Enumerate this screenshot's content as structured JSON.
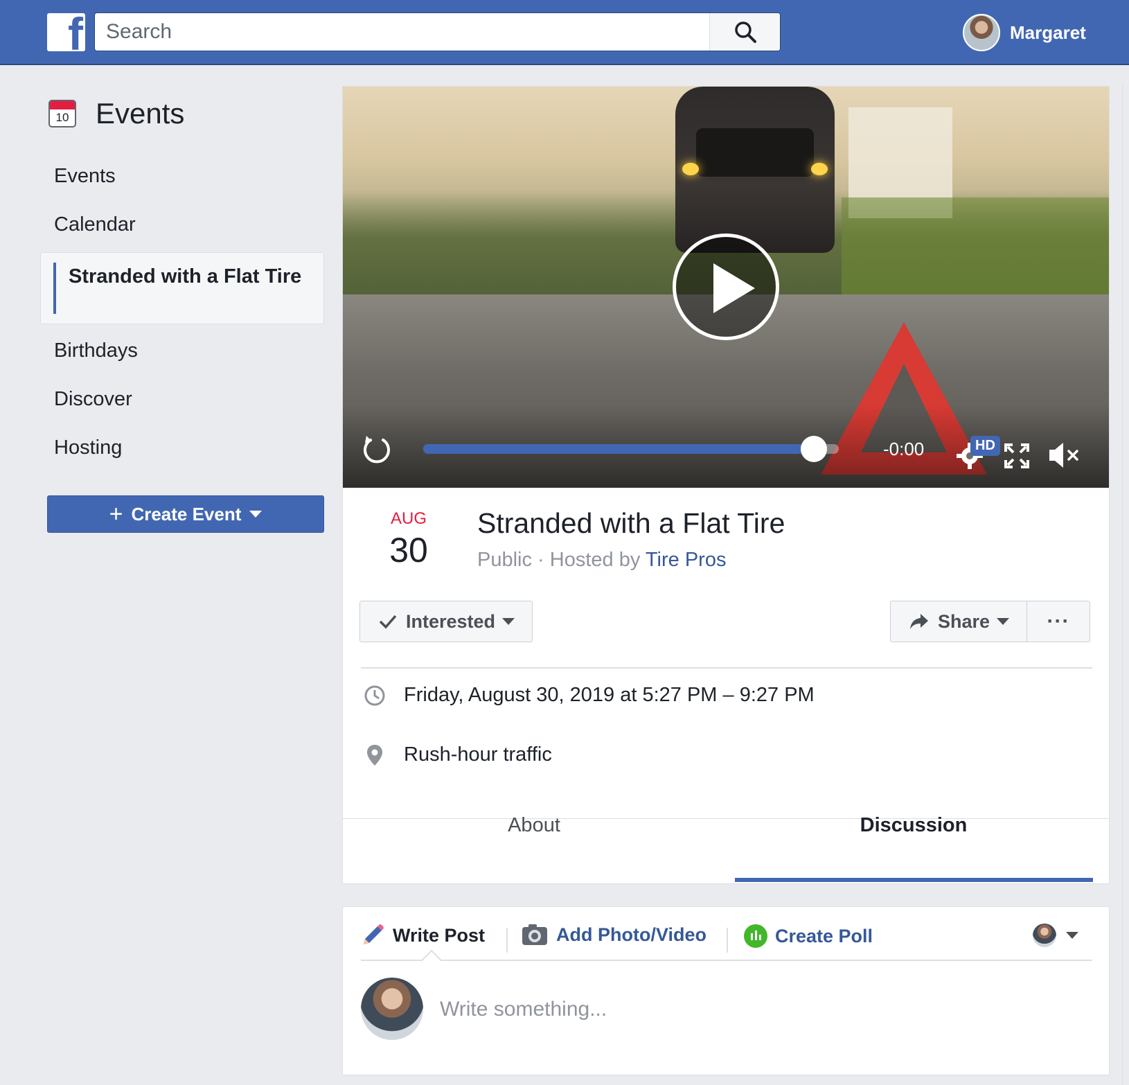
{
  "topbar": {
    "logo_letter": "f",
    "search_placeholder": "Search",
    "user_name": "Margaret"
  },
  "sidebar": {
    "title": "Events",
    "calendar_icon_number": "10",
    "items": [
      {
        "label": "Events"
      },
      {
        "label": "Calendar"
      },
      {
        "label": "Stranded with a Flat Tire",
        "active": true
      },
      {
        "label": "Birthdays"
      },
      {
        "label": "Discover"
      },
      {
        "label": "Hosting"
      }
    ],
    "create_button_label": "Create Event"
  },
  "video": {
    "time_remaining": "-0:00",
    "progress": 0.94,
    "hd_label": "HD"
  },
  "event": {
    "month": "AUG",
    "day": "30",
    "title": "Stranded with a Flat Tire",
    "privacy": "Public",
    "separator": " · ",
    "hosted_by_prefix": "Hosted by ",
    "host": "Tire Pros",
    "interested_label": "Interested",
    "share_label": "Share",
    "more_label": "···",
    "datetime": "Friday, August 30, 2019 at 5:27 PM – 9:27 PM",
    "location": "Rush-hour traffic"
  },
  "tabs": [
    {
      "label": "About",
      "active": false
    },
    {
      "label": "Discussion",
      "active": true
    }
  ],
  "composer": {
    "write_post_label": "Write Post",
    "add_photo_label": "Add Photo/Video",
    "create_poll_label": "Create Poll",
    "placeholder": "Write something..."
  },
  "colors": {
    "brand_blue": "#4267b2",
    "link_blue": "#365899",
    "date_red": "#e41e3f",
    "poll_green": "#42b72a"
  }
}
